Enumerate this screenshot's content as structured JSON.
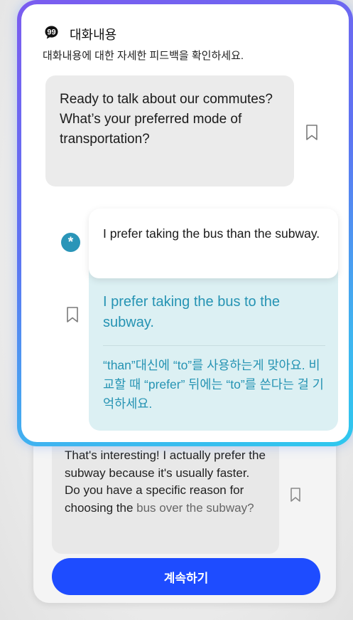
{
  "header": {
    "title": "대화내용",
    "subtitle": "대화내용에 대한 자세한 피드백을 확인하세요."
  },
  "messages": {
    "ai_message": "Ready to talk about our commutes? What’s your preferred mode of transportation?",
    "user_message": "I prefer taking the bus than the subway.",
    "avatar_symbol": "*",
    "corrected_sentence": "I prefer taking the bus to the subway.",
    "explanation": "“than”대신에 “to”를 사용하는게 맞아요. 비교할 때 “prefer” 뒤에는 “to”를 쓴다는 걸 기억하세요.",
    "background_ai_message_main": "That's interesting! I actually prefer the subway because it's usually faster. Do you have a specific reason for choosing the",
    "background_ai_message_faded": "bus over the subway?"
  },
  "actions": {
    "continue_label": "계속하기"
  },
  "colors": {
    "accent_blue": "#1e4cff",
    "feedback_teal": "#2593b3",
    "feedback_bg": "#dcf0f3",
    "border_gradient_start": "#7b5cf0",
    "border_gradient_end": "#2ec8ee"
  },
  "icons": {
    "header": "quote-bubble-icon",
    "bookmark": "bookmark-icon",
    "avatar": "asterisk-avatar-icon"
  }
}
